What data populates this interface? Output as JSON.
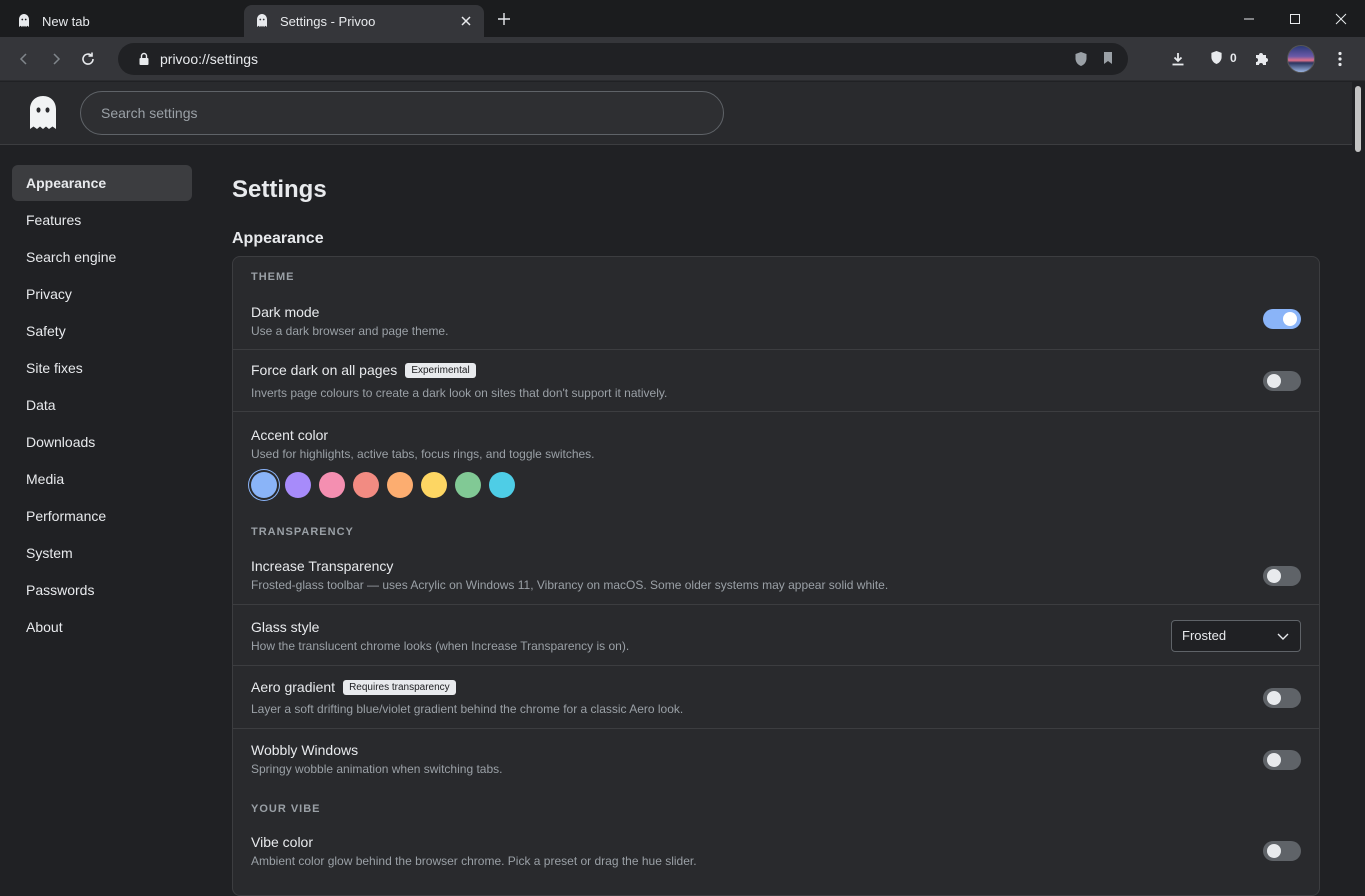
{
  "browser": {
    "tabs": [
      {
        "label": "New tab",
        "active": false
      },
      {
        "label": "Settings - Privoo",
        "active": true
      }
    ],
    "url": "privoo://settings",
    "shield_count": "0"
  },
  "header": {
    "search_placeholder": "Search settings"
  },
  "sidebar": {
    "items": [
      {
        "label": "Appearance",
        "active": true
      },
      {
        "label": "Features"
      },
      {
        "label": "Search engine"
      },
      {
        "label": "Privacy"
      },
      {
        "label": "Safety"
      },
      {
        "label": "Site fixes"
      },
      {
        "label": "Data"
      },
      {
        "label": "Downloads"
      },
      {
        "label": "Media"
      },
      {
        "label": "Performance"
      },
      {
        "label": "System"
      },
      {
        "label": "Passwords"
      },
      {
        "label": "About"
      }
    ]
  },
  "main": {
    "title": "Settings",
    "section": "Appearance",
    "groups": {
      "theme": "THEME",
      "transparency": "TRANSPARENCY",
      "vibe": "YOUR VIBE"
    },
    "settings": {
      "dark_mode": {
        "title": "Dark mode",
        "desc": "Use a dark browser and page theme.",
        "on": true
      },
      "force_dark": {
        "title": "Force dark on all pages",
        "badge": "Experimental",
        "desc": "Inverts page colours to create a dark look on sites that don't support it natively.",
        "on": false
      },
      "accent": {
        "title": "Accent color",
        "desc": "Used for highlights, active tabs, focus rings, and toggle switches.",
        "swatches": [
          "#8ab4f8",
          "#a78bfa",
          "#f48fb1",
          "#f28b82",
          "#fcad70",
          "#fdd663",
          "#81c995",
          "#4ecde6"
        ],
        "selected": 0
      },
      "increase_transparency": {
        "title": "Increase Transparency",
        "desc": "Frosted-glass toolbar — uses Acrylic on Windows 11, Vibrancy on macOS. Some older systems may appear solid white.",
        "on": false
      },
      "glass_style": {
        "title": "Glass style",
        "desc": "How the translucent chrome looks (when Increase Transparency is on).",
        "value": "Frosted"
      },
      "aero": {
        "title": "Aero gradient",
        "badge": "Requires transparency",
        "desc": "Layer a soft drifting blue/violet gradient behind the chrome for a classic Aero look.",
        "on": false
      },
      "wobbly": {
        "title": "Wobbly Windows",
        "desc": "Springy wobble animation when switching tabs.",
        "on": false
      },
      "vibe_color": {
        "title": "Vibe color",
        "desc": "Ambient color glow behind the browser chrome. Pick a preset or drag the hue slider.",
        "on": false
      }
    }
  }
}
